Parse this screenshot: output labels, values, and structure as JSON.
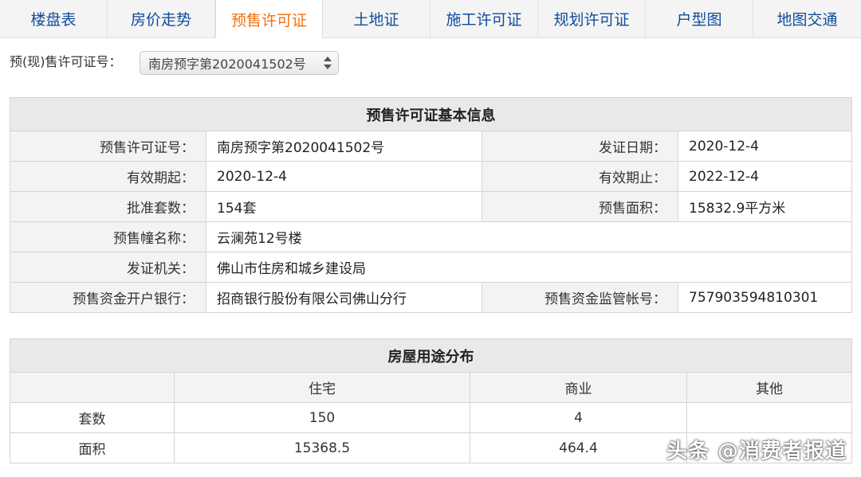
{
  "tabs": [
    {
      "label": "楼盘表",
      "active": false
    },
    {
      "label": "房价走势",
      "active": false
    },
    {
      "label": "预售许可证",
      "active": true
    },
    {
      "label": "土地证",
      "active": false
    },
    {
      "label": "施工许可证",
      "active": false
    },
    {
      "label": "规划许可证",
      "active": false
    },
    {
      "label": "户型图",
      "active": false
    },
    {
      "label": "地图交通",
      "active": false
    }
  ],
  "selector": {
    "label": "预(现)售许可证号：",
    "value": "南房预字第2020041502号"
  },
  "basic_info": {
    "title": "预售许可证基本信息",
    "rows": [
      {
        "l1": "预售许可证号：",
        "v1": "南房预字第2020041502号",
        "l2": "发证日期：",
        "v2": "2020-12-4"
      },
      {
        "l1": "有效期起：",
        "v1": "2020-12-4",
        "l2": "有效期止：",
        "v2": "2022-12-4"
      },
      {
        "l1": "批准套数：",
        "v1": "154套",
        "l2": "预售面积：",
        "v2": "15832.9平方米"
      },
      {
        "l1": "预售幢名称：",
        "v1": "云澜苑12号楼"
      },
      {
        "l1": "发证机关：",
        "v1": "佛山市住房和城乡建设局"
      },
      {
        "l1": "预售资金开户银行：",
        "v1": "招商银行股份有限公司佛山分行",
        "l2": "预售资金监管帐号：",
        "v2": "757903594810301"
      }
    ]
  },
  "usage": {
    "title": "房屋用途分布",
    "headers": [
      "住宅",
      "商业",
      "其他"
    ],
    "rows": [
      {
        "label": "套数",
        "values": [
          "150",
          "4",
          ""
        ]
      },
      {
        "label": "面积",
        "values": [
          "15368.5",
          "464.4",
          ""
        ]
      }
    ]
  },
  "watermark": "头条 @消费者报道",
  "colors": {
    "active_tab": "#f2700b",
    "tab_text": "#0f4c9c"
  }
}
